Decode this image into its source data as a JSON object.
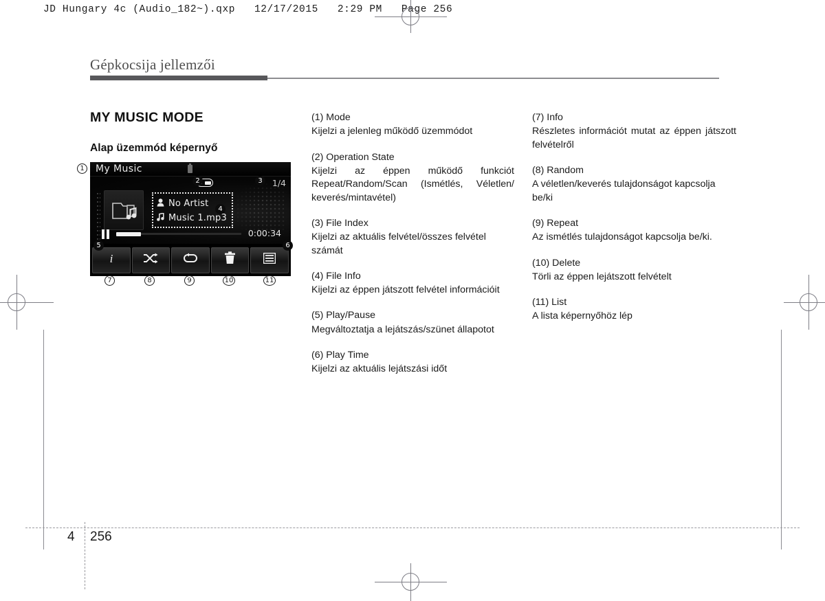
{
  "print_slug": "JD Hungary 4c (Audio_182~).qxp   12/17/2015   2:29 PM   Page 256",
  "running_head": "Gépkocsija jellemzői",
  "section": {
    "title": "MY MUSIC MODE",
    "subtitle": "Alap üzemmód képernyő"
  },
  "device": {
    "title": "My Music",
    "usb_icon": "usb-device-icon",
    "operation_state_icon": "repeat-one-icon",
    "operation_state_label": "1",
    "file_index": "1/4",
    "album_art_icon": "folder-music-icon",
    "file_info": {
      "artist_icon": "person-icon",
      "artist": "No Artist",
      "track_icon": "music-note-icon",
      "track": "Music 1.mp3"
    },
    "playback": {
      "state_icon": "pause-icon",
      "progress_percent": 20,
      "play_time": "0:00:34"
    },
    "buttons": [
      {
        "icon": "info-icon",
        "name": "info-button"
      },
      {
        "icon": "shuffle-icon",
        "name": "random-button"
      },
      {
        "icon": "repeat-icon",
        "name": "repeat-button"
      },
      {
        "icon": "trash-icon",
        "name": "delete-button"
      },
      {
        "icon": "list-icon",
        "name": "list-button"
      }
    ]
  },
  "callouts": {
    "c1": "1",
    "c2": "2",
    "c3": "3",
    "c4": "4",
    "c5": "5",
    "c6": "6",
    "c7": "7",
    "c8": "8",
    "c9": "9",
    "c10": "10",
    "c11": "11"
  },
  "middle_column": [
    {
      "term": "(1) Mode",
      "desc": "Kijelzi a jelenleg működő üzemmódot",
      "justify": false
    },
    {
      "term": "(2) Operation State",
      "desc": "Kijelzi az éppen működő funkciót Repeat/Random/Scan (Ismétlés, Véletlen/ keverés/mintavétel)",
      "justify": true
    },
    {
      "term": "(3) File Index",
      "desc": "Kijelzi az aktuális felvétel/összes felvétel számát",
      "justify": false
    },
    {
      "term": "(4) File Info",
      "desc": "Kijelzi az éppen játszott felvétel információit",
      "justify": true
    },
    {
      "term": "(5) Play/Pause",
      "desc": "Megváltoztatja a lejátszás/szünet állapotot",
      "justify": false
    },
    {
      "term": "(6) Play Time",
      "desc": "Kijelzi az aktuális lejátszási időt",
      "justify": false
    }
  ],
  "right_column": [
    {
      "term": "(7) Info",
      "desc": "Részletes információt mutat az éppen játszott felvételről",
      "justify": true
    },
    {
      "term": "(8) Random",
      "desc": "A véletlen/keverés tulajdonságot kapcsolja be/ki",
      "justify": false
    },
    {
      "term": "(9) Repeat",
      "desc": "Az ismétlés tulajdonságot kapcsolja be/ki.",
      "justify": true
    },
    {
      "term": "(10) Delete",
      "desc": "Törli az éppen lejátszott felvételt",
      "justify": false
    },
    {
      "term": "(11) List",
      "desc": "A lista képernyőhöz lép",
      "justify": false
    }
  ],
  "footer": {
    "chapter": "4",
    "page": "256"
  },
  "colors": {
    "head_bar": "#58585b",
    "head_rule": "#8d8d90",
    "text": "#1b1b1b",
    "device_bg": "#050505"
  }
}
